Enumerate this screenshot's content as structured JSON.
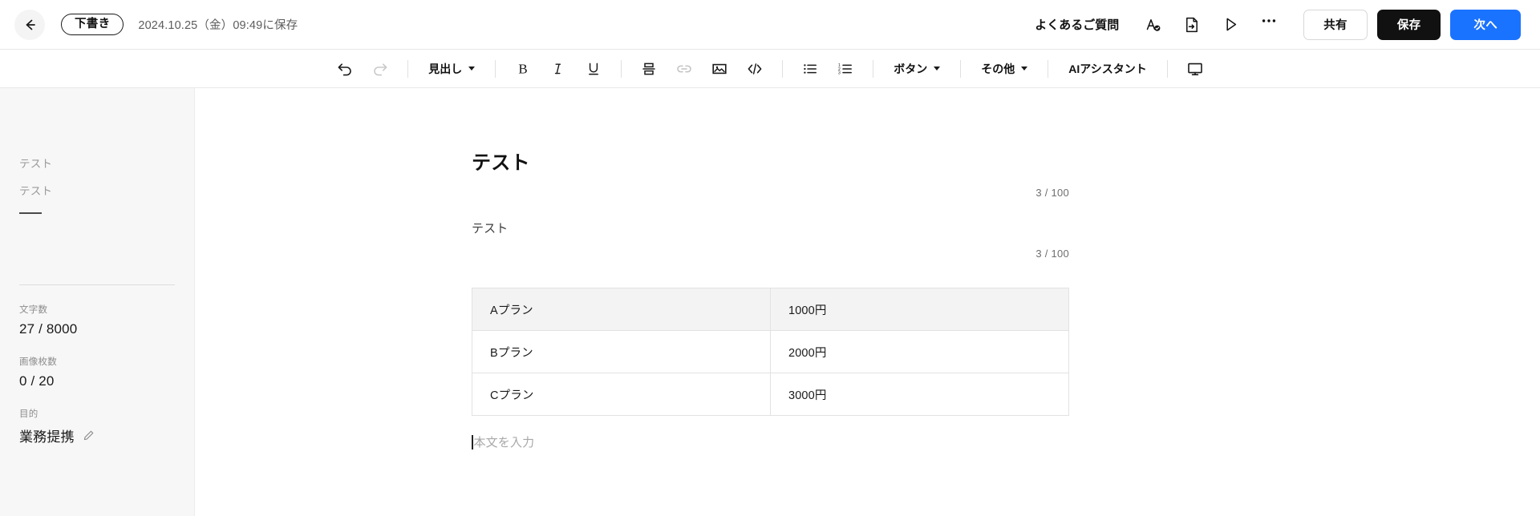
{
  "header": {
    "back_icon": "back-arrow-icon",
    "status_badge": "下書き",
    "saved_time": "2024.10.25（金）09:49に保存",
    "faq_label": "よくあるご質問",
    "spellcheck_icon": "spellcheck-icon",
    "export_icon": "document-export-icon",
    "preview_icon": "play-preview-icon",
    "more_icon": "more-options-icon",
    "share_label": "共有",
    "save_label": "保存",
    "next_label": "次へ",
    "accent_color": "#1a73ff",
    "save_color": "#111111"
  },
  "toolbar": {
    "undo_icon": "undo-icon",
    "redo_icon": "redo-icon",
    "heading_label": "見出し",
    "bold_label": "B",
    "italic_label": "I",
    "underline_label": "U",
    "divider_icon": "horizontal-rule-icon",
    "link_icon": "link-icon",
    "image_icon": "image-icon",
    "code_icon": "code-icon",
    "bullet_list_icon": "bullet-list-icon",
    "numbered_list_icon": "numbered-list-icon",
    "button_label": "ボタン",
    "other_label": "その他",
    "ai_assistant_label": "AIアシスタント",
    "preview_device_icon": "desktop-preview-icon"
  },
  "sidebar": {
    "outline": [
      {
        "label": "テスト"
      },
      {
        "label": "テスト"
      }
    ],
    "stats": [
      {
        "label": "文字数",
        "value": "27 / 8000"
      },
      {
        "label": "画像枚数",
        "value": "0 / 20"
      }
    ],
    "purpose": {
      "label": "目的",
      "value": "業務提携",
      "edit_icon": "pencil-edit-icon"
    }
  },
  "editor": {
    "title": "テスト",
    "title_counter": "3 / 100",
    "subtitle": "テスト",
    "subtitle_counter": "3 / 100",
    "table": {
      "rows": [
        {
          "plan": "Aプラン",
          "price": "1000円"
        },
        {
          "plan": "Bプラン",
          "price": "2000円"
        },
        {
          "plan": "Cプラン",
          "price": "3000円"
        }
      ]
    },
    "body_placeholder": "本文を入力"
  }
}
